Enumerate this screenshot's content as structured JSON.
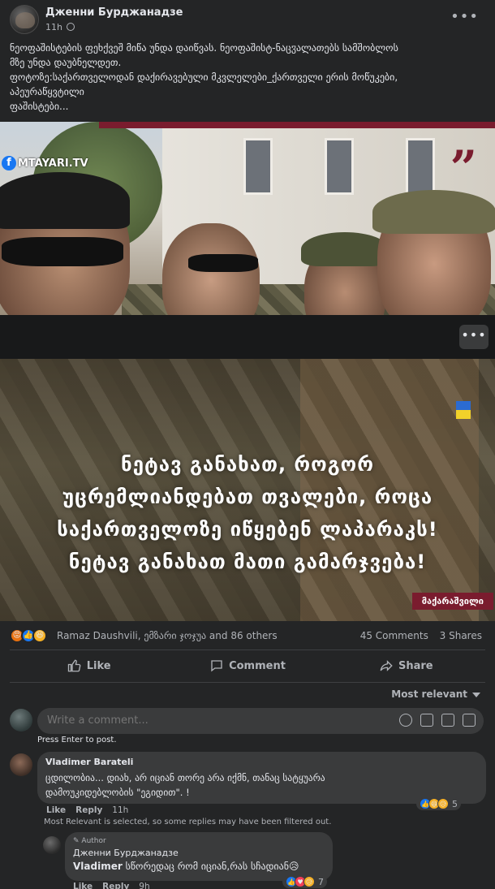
{
  "post": {
    "author": "Дженни Бурджанадзе",
    "time": "11h",
    "text_lines": [
      "ნეოფაშისტების ფეხქვეშ მიწა უნდა დაიწვას. ნეოფაშისტ-ნაცჳალათებს  სამშობლოს",
      "მზე უნდა დაუბნელდეთ.",
      "ფოტოზე:საქართველოდან დაქირავებული მკვლელები_ქართველი ერის მოწუკები,",
      "აპეურაწყვტილი",
      "ფაშისტები..."
    ]
  },
  "image": {
    "logo_text": "MTAYARI.TV",
    "overlay_lines": [
      "ნეტავ განახათ, როგორ",
      "უცრემლიანდებათ თვალები, როცა",
      "საქართველოზე იწყებენ ლაპარაკს!",
      "ნეტავ განახათ მათი გამარჯვება!"
    ],
    "signature_tag": "მაქარაშვილი"
  },
  "reactions": {
    "names": "Ramaz Daushvili, ემზარი ჯოჯუა and 86 others",
    "comments": "45 Comments",
    "shares": "3 Shares"
  },
  "actions": {
    "like": "Like",
    "comment": "Comment",
    "share": "Share"
  },
  "sort": "Most relevant",
  "composer": {
    "placeholder": "Write a comment...",
    "hint": "Press Enter to post."
  },
  "comments": [
    {
      "name": "Vladimer Barateli",
      "text_lines": [
        "ცდილობია... დიახ, არ იციან თორე არა იქმნ, თანაც სატყუარა",
        "დამოუკიდებლობის \"ეგიდით\". !"
      ],
      "like": "Like",
      "reply": "Reply",
      "time": "11h",
      "reaction_count": "5"
    }
  ],
  "filter_note": "Most Relevant is selected, so some replies may have been filtered out.",
  "reply": {
    "author_tag": "Author",
    "name": "Дженни Бурджанадзе",
    "mention": "Vladimer",
    "text": " სწორედაც რომ იციან,რას სჩადიან😥",
    "reaction_count": "7",
    "like": "Like",
    "reply": "Reply",
    "time": "9h"
  }
}
